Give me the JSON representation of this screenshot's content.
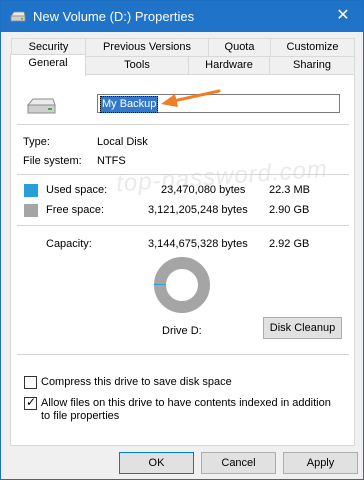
{
  "window": {
    "title": "New Volume (D:) Properties",
    "close_glyph": "✕"
  },
  "tabs": {
    "row1": [
      "Security",
      "Previous Versions",
      "Quota",
      "Customize"
    ],
    "row2": [
      "General",
      "Tools",
      "Hardware",
      "Sharing"
    ],
    "active": "General"
  },
  "general": {
    "volume_name": "My Backup",
    "type_label": "Type:",
    "type_value": "Local Disk",
    "fs_label": "File system:",
    "fs_value": "NTFS",
    "used_label": "Used space:",
    "used_bytes": "23,470,080 bytes",
    "used_size": "22.3 MB",
    "free_label": "Free space:",
    "free_bytes": "3,121,205,248 bytes",
    "free_size": "2.90 GB",
    "capacity_label": "Capacity:",
    "capacity_bytes": "3,144,675,328 bytes",
    "capacity_size": "2.92 GB",
    "drive_label": "Drive D:",
    "cleanup_label": "Disk Cleanup",
    "compress_label": "Compress this drive to save disk space",
    "compress_checked": false,
    "index_label_line1": "Allow files on this drive to have contents indexed in addition",
    "index_label_line2": "to file properties",
    "index_checked": true,
    "used_fraction": 0.0075,
    "watermark": "top-password.com"
  },
  "colors": {
    "used": "#26a0da",
    "free": "#a5a5a5",
    "title_bar": "#1f73c8",
    "arrow": "#f07e22"
  },
  "icons": {
    "drive": "hard-drive-icon",
    "check": "check-icon",
    "close": "close-icon"
  },
  "footer": {
    "ok": "OK",
    "cancel": "Cancel",
    "apply": "Apply"
  }
}
